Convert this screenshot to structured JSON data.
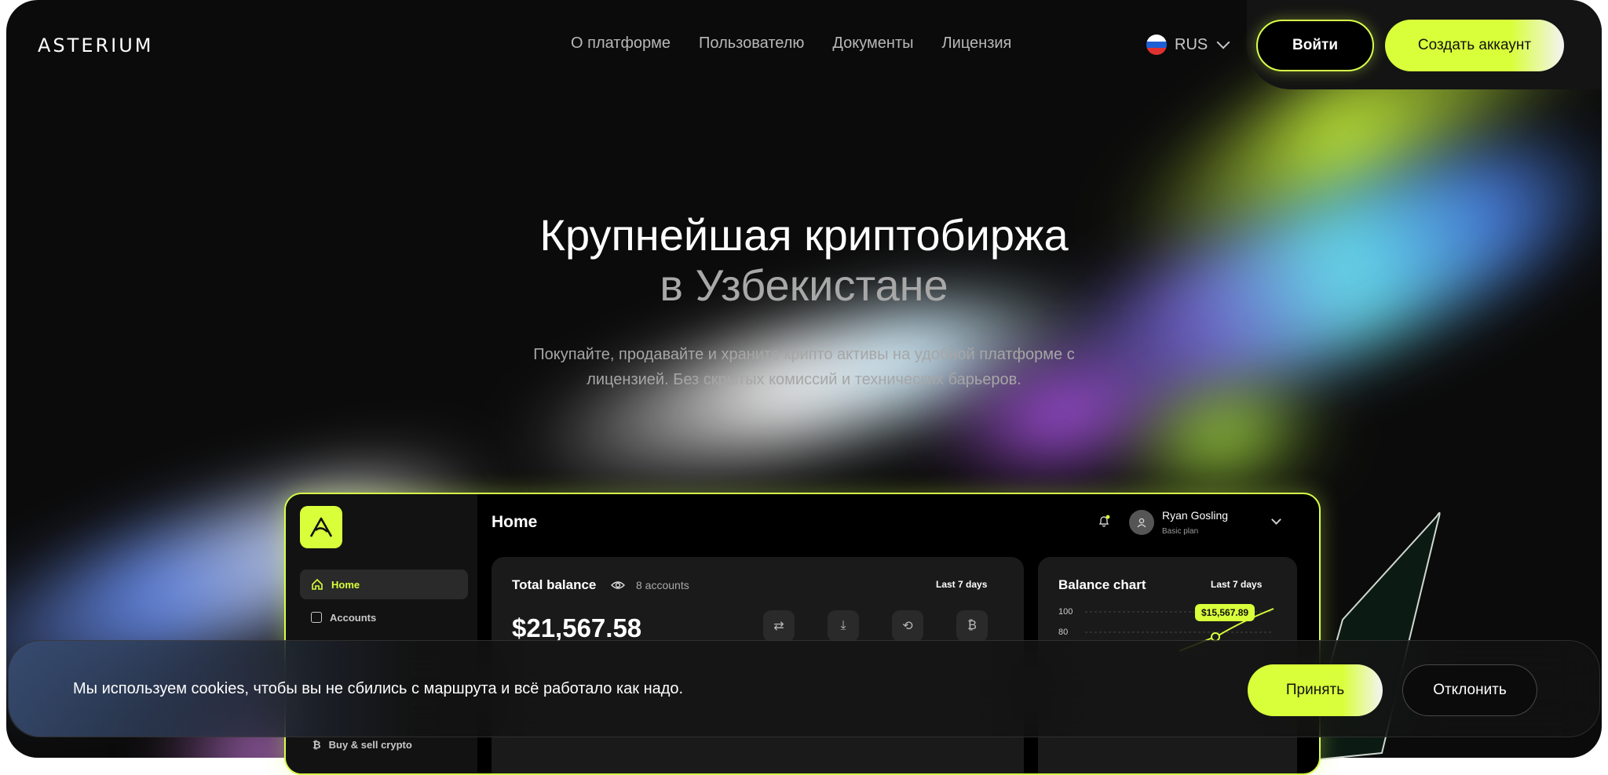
{
  "brand": {
    "logo": "ASTERIUM",
    "accent": "#d8ff3a"
  },
  "nav": {
    "items": [
      "О платформе",
      "Пользователю",
      "Документы",
      "Лицензия"
    ]
  },
  "language": {
    "label": "RUS",
    "flag_colors": [
      "#ffffff",
      "#1f5fd6",
      "#e03131"
    ]
  },
  "header": {
    "login_label": "Войти",
    "create_label": "Создать аккаунт"
  },
  "hero": {
    "title_line1": "Крупнейшая криптобиржа",
    "title_line2": "в Узбекистане",
    "subtitle": "Покупайте, продавайте и храните крипто активы на удобной платформе с лицензией. Без скрытых комиссий и технических барьеров."
  },
  "dashboard": {
    "page_title": "Home",
    "user": {
      "name": "Ryan Gosling",
      "plan": "Basic plan"
    },
    "sidebar": [
      {
        "label": "Home",
        "active": true
      },
      {
        "label": "Accounts",
        "active": false
      },
      {
        "label": "Buy & sell crypto",
        "active": false
      }
    ],
    "balance": {
      "title": "Total balance",
      "accounts": "8 accounts",
      "period": "Last 7 days",
      "amount": "$21,567.58",
      "actions": [
        "transfer-icon",
        "download-icon",
        "exchange-icon",
        "bitcoin-icon"
      ]
    },
    "chart": {
      "title": "Balance chart",
      "period": "Last 7 days",
      "y_ticks": [
        "100",
        "80"
      ],
      "tooltip": "$15,567.89"
    }
  },
  "cookie": {
    "text": "Мы используем cookies, чтобы вы не сбились с маршрута и всё работало как надо.",
    "accept_label": "Принять",
    "decline_label": "Отклонить"
  }
}
